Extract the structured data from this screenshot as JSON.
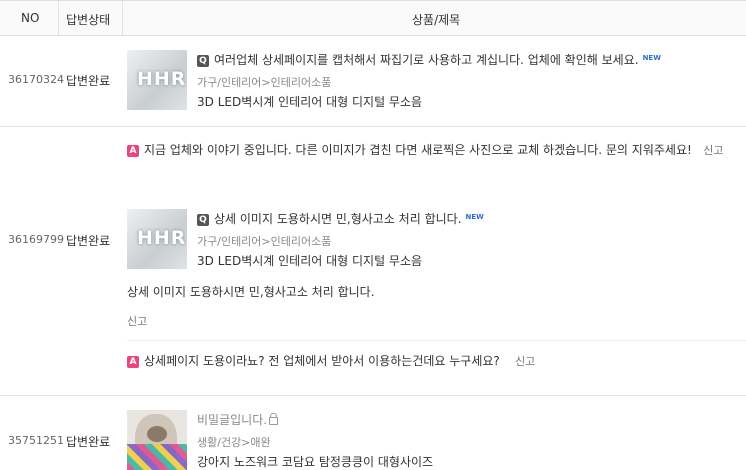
{
  "header": {
    "no": "NO",
    "status": "답변상태",
    "title": "상품/제목"
  },
  "rows": [
    {
      "no": "36170324",
      "status": "답변완료",
      "question": "여러업체 상세페이지를 캡처해서 짜집기로 사용하고 계십니다. 업체에 확인해 보세요.",
      "new_label": "NEW",
      "category": "가구/인테리어>인테리어소품",
      "product": "3D LED벽시계 인테리어 대형 디지털 무소음",
      "answer": "지금 업체와 이야기 중입니다. 다른 이미지가 겹친 다면 새로찍은 사진으로 교체 하겠습니다. 문의 지워주세요!",
      "report": "신고"
    },
    {
      "no": "36169799",
      "status": "답변완료",
      "question": "상세 이미지 도용하시면 민,형사고소 처리 합니다.",
      "new_label": "NEW",
      "category": "가구/인테리어>인테리어소품",
      "product": "3D LED벽시계 인테리어 대형 디지털 무소음",
      "body": "상세 이미지 도용하시면 민,형사고소 처리 합니다.",
      "report": "신고",
      "answer": "상세페이지 도용이라뇨? 전 업체에서 받아서 이용하는건데요 누구세요?",
      "answer_report": "신고"
    },
    {
      "no": "35751251",
      "status": "답변완료",
      "question": "비밀글입니다.",
      "category": "생활/건강>애완",
      "product": "강아지 노즈워크 코담요 탐정킁킁이 대형사이즈"
    }
  ],
  "badges": {
    "q": "Q",
    "a": "A"
  },
  "thumb_led_text": "HHR"
}
